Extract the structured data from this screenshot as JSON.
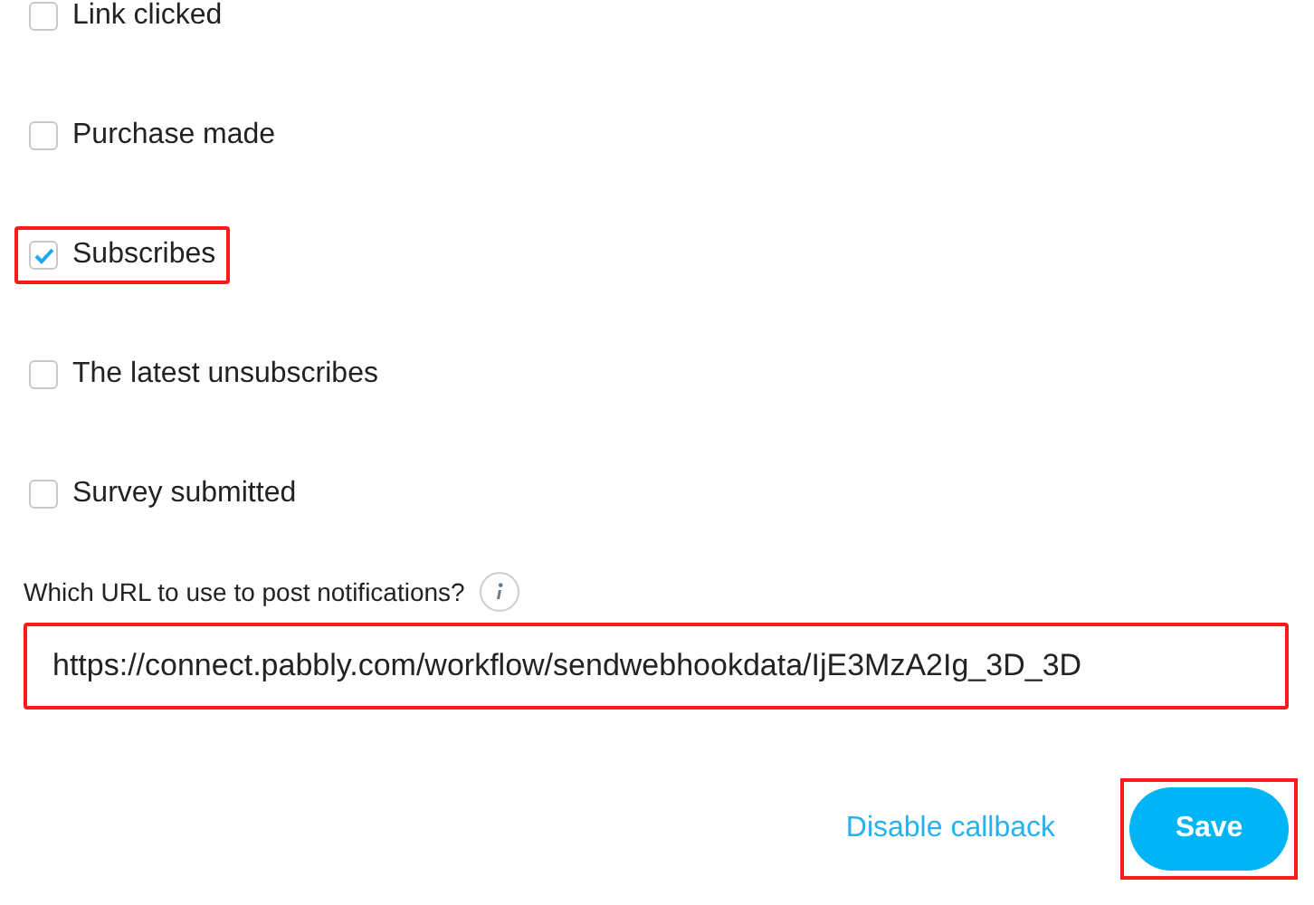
{
  "events": [
    {
      "label": "Link clicked",
      "checked": false,
      "highlighted": false
    },
    {
      "label": "Purchase made",
      "checked": false,
      "highlighted": false
    },
    {
      "label": "Subscribes",
      "checked": true,
      "highlighted": true
    },
    {
      "label": "The latest unsubscribes",
      "checked": false,
      "highlighted": false
    },
    {
      "label": "Survey submitted",
      "checked": false,
      "highlighted": false
    }
  ],
  "url_field": {
    "label": "Which URL to use to post notifications?",
    "value": "https://connect.pabbly.com/workflow/sendwebhookdata/IjE3MzA2Ig_3D_3D",
    "highlighted": true
  },
  "actions": {
    "disable_link": "Disable callback",
    "save_button": "Save",
    "save_highlighted": true
  }
}
